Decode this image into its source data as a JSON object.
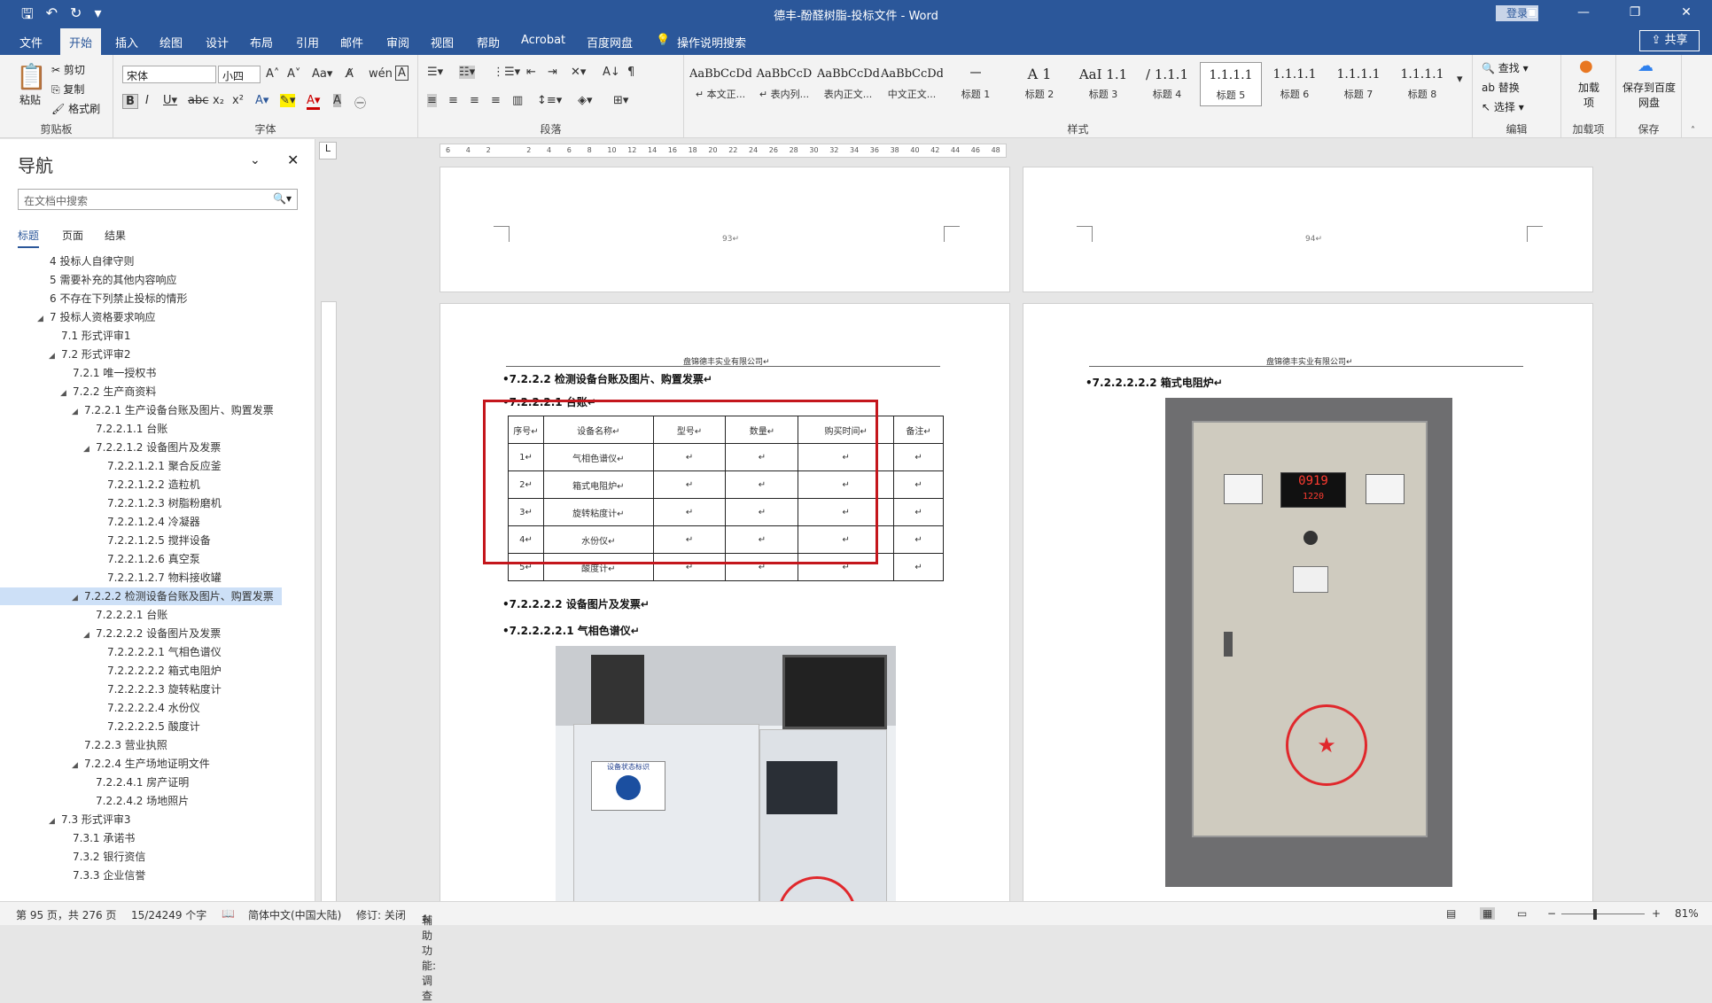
{
  "window": {
    "title": "德丰-酚醛树脂-投标文件  -  Word",
    "login": "登录"
  },
  "tabs": [
    "文件",
    "开始",
    "插入",
    "绘图",
    "设计",
    "布局",
    "引用",
    "邮件",
    "审阅",
    "视图",
    "帮助",
    "Acrobat",
    "百度网盘"
  ],
  "tellme": "操作说明搜索",
  "share": "共享",
  "ribbon": {
    "clipboard": {
      "paste": "粘贴",
      "cut": "剪切",
      "copy": "复制",
      "format_painter": "格式刷",
      "label": "剪贴板"
    },
    "font": {
      "name": "宋体",
      "size": "小四",
      "label": "字体"
    },
    "paragraph": {
      "label": "段落"
    },
    "styles": {
      "label": "样式",
      "items": [
        {
          "sample": "AaBbCcDdI",
          "name": "↵ 本文正..."
        },
        {
          "sample": "AaBbCcD",
          "name": "↵ 表内列..."
        },
        {
          "sample": "AaBbCcDd",
          "name": "表内正文..."
        },
        {
          "sample": "AaBbCcDd",
          "name": "中文正文..."
        },
        {
          "sample": "一",
          "name": "标题 1"
        },
        {
          "sample": "A 1",
          "name": "标题 2"
        },
        {
          "sample": "AaI 1.1",
          "name": "标题 3"
        },
        {
          "sample": "/ 1.1.1",
          "name": "标题 4"
        },
        {
          "sample": "1.1.1.1",
          "name": "标题 5"
        },
        {
          "sample": "1.1.1.1",
          "name": "标题 6"
        },
        {
          "sample": "1.1.1.1",
          "name": "标题 7"
        },
        {
          "sample": "1.1.1.1",
          "name": "标题 8"
        }
      ]
    },
    "editing": {
      "find": "查找",
      "replace": "替换",
      "select": "选择",
      "label": "编辑"
    },
    "addins": {
      "load": "加载项",
      "label": "加载项"
    },
    "baidu": {
      "save": "保存到百度网盘",
      "label": "保存"
    }
  },
  "nav": {
    "title": "导航",
    "search_placeholder": "在文档中搜索",
    "tabs": [
      "标题",
      "页面",
      "结果"
    ],
    "items": [
      {
        "text": "4 投标人自律守则",
        "level": 0,
        "tri": ""
      },
      {
        "text": "5 需要补充的其他内容响应",
        "level": 0,
        "tri": ""
      },
      {
        "text": "6 不存在下列禁止投标的情形",
        "level": 0,
        "tri": ""
      },
      {
        "text": "7 投标人资格要求响应",
        "level": 0,
        "tri": "◢"
      },
      {
        "text": "7.1 形式评审1",
        "level": 1,
        "tri": ""
      },
      {
        "text": "7.2 形式评审2",
        "level": 1,
        "tri": "◢"
      },
      {
        "text": "7.2.1 唯一授权书",
        "level": 2,
        "tri": ""
      },
      {
        "text": "7.2.2 生产商资料",
        "level": 2,
        "tri": "◢"
      },
      {
        "text": "7.2.2.1 生产设备台账及图片、购置发票",
        "level": 3,
        "tri": "◢"
      },
      {
        "text": "7.2.2.1.1 台账",
        "level": 4,
        "tri": ""
      },
      {
        "text": "7.2.2.1.2 设备图片及发票",
        "level": 4,
        "tri": "◢"
      },
      {
        "text": "7.2.2.1.2.1 聚合反应釜",
        "level": 5,
        "tri": ""
      },
      {
        "text": "7.2.2.1.2.2 造粒机",
        "level": 5,
        "tri": ""
      },
      {
        "text": "7.2.2.1.2.3 树脂粉磨机",
        "level": 5,
        "tri": ""
      },
      {
        "text": "7.2.2.1.2.4 冷凝器",
        "level": 5,
        "tri": ""
      },
      {
        "text": "7.2.2.1.2.5 搅拌设备",
        "level": 5,
        "tri": ""
      },
      {
        "text": "7.2.2.1.2.6 真空泵",
        "level": 5,
        "tri": ""
      },
      {
        "text": "7.2.2.1.2.7 物料接收罐",
        "level": 5,
        "tri": ""
      },
      {
        "text": "7.2.2.2 检测设备台账及图片、购置发票",
        "level": 3,
        "tri": "◢",
        "selected": true
      },
      {
        "text": "7.2.2.2.1 台账",
        "level": 4,
        "tri": ""
      },
      {
        "text": "7.2.2.2.2 设备图片及发票",
        "level": 4,
        "tri": "◢"
      },
      {
        "text": "7.2.2.2.2.1 气相色谱仪",
        "level": 5,
        "tri": ""
      },
      {
        "text": "7.2.2.2.2.2 箱式电阻炉",
        "level": 5,
        "tri": ""
      },
      {
        "text": "7.2.2.2.2.3 旋转粘度计",
        "level": 5,
        "tri": ""
      },
      {
        "text": "7.2.2.2.2.4 水份仪",
        "level": 5,
        "tri": ""
      },
      {
        "text": "7.2.2.2.2.5 酸度计",
        "level": 5,
        "tri": ""
      },
      {
        "text": "7.2.2.3 营业执照",
        "level": 3,
        "tri": ""
      },
      {
        "text": "7.2.2.4 生产场地证明文件",
        "level": 3,
        "tri": "◢"
      },
      {
        "text": "7.2.2.4.1 房产证明",
        "level": 4,
        "tri": ""
      },
      {
        "text": "7.2.2.4.2 场地照片",
        "level": 4,
        "tri": ""
      },
      {
        "text": "7.3 形式评审3",
        "level": 1,
        "tri": "◢"
      },
      {
        "text": "7.3.1 承诺书",
        "level": 2,
        "tri": ""
      },
      {
        "text": "7.3.2 银行资信",
        "level": 2,
        "tri": ""
      },
      {
        "text": "7.3.3 企业信誉",
        "level": 2,
        "tri": ""
      }
    ]
  },
  "ruler": {
    "h_ticks": [
      "6",
      "4",
      "2",
      "",
      "2",
      "4",
      "6",
      "8",
      "10",
      "12",
      "14",
      "16",
      "18",
      "20",
      "22",
      "24",
      "26",
      "28",
      "30",
      "32",
      "34",
      "36",
      "38",
      "40",
      "42",
      "44",
      "46",
      "48"
    ]
  },
  "document": {
    "page93_num": "93↵",
    "page94_num": "94↵",
    "company": "盘锦德丰实业有限公司↵",
    "h_7222": "7.2.2.2 检测设备台账及图片、购置发票↵",
    "h_72221": "7.2.2.2.1 台账↵",
    "table_headers": [
      "序号↵",
      "设备名称↵",
      "型号↵",
      "数量↵",
      "购买时间↵",
      "备注↵"
    ],
    "table_rows": [
      [
        "1↵",
        "气相色谱仪↵",
        "↵",
        "↵",
        "↵",
        "↵"
      ],
      [
        "2↵",
        "箱式电阻炉↵",
        "↵",
        "↵",
        "↵",
        "↵"
      ],
      [
        "3↵",
        "旋转粘度计↵",
        "↵",
        "↵",
        "↵",
        "↵"
      ],
      [
        "4↵",
        "水份仪↵",
        "↵",
        "↵",
        "↵",
        "↵"
      ],
      [
        "5↵",
        "酸度计↵",
        "↵",
        "↵",
        "↵",
        "↵"
      ]
    ],
    "h_72222": "7.2.2.2.2 设备图片及发票↵",
    "h_722221": "7.2.2.2.2.1    气相色谱仪↵",
    "h_722222": "7.2.2.2.2.2    箱式电阻炉↵",
    "photo_label": "设备状态标识",
    "display": "0919",
    "display2": "1220"
  },
  "status": {
    "page": "第 95 页，共 276 页",
    "words": "15/24249 个字",
    "lang": "简体中文(中国大陆)",
    "track": "修订: 关闭",
    "access": "辅助功能: 调查",
    "zoom": "81%"
  },
  "colors": {
    "brand": "#2b579a",
    "highlight": "#c4161c"
  }
}
